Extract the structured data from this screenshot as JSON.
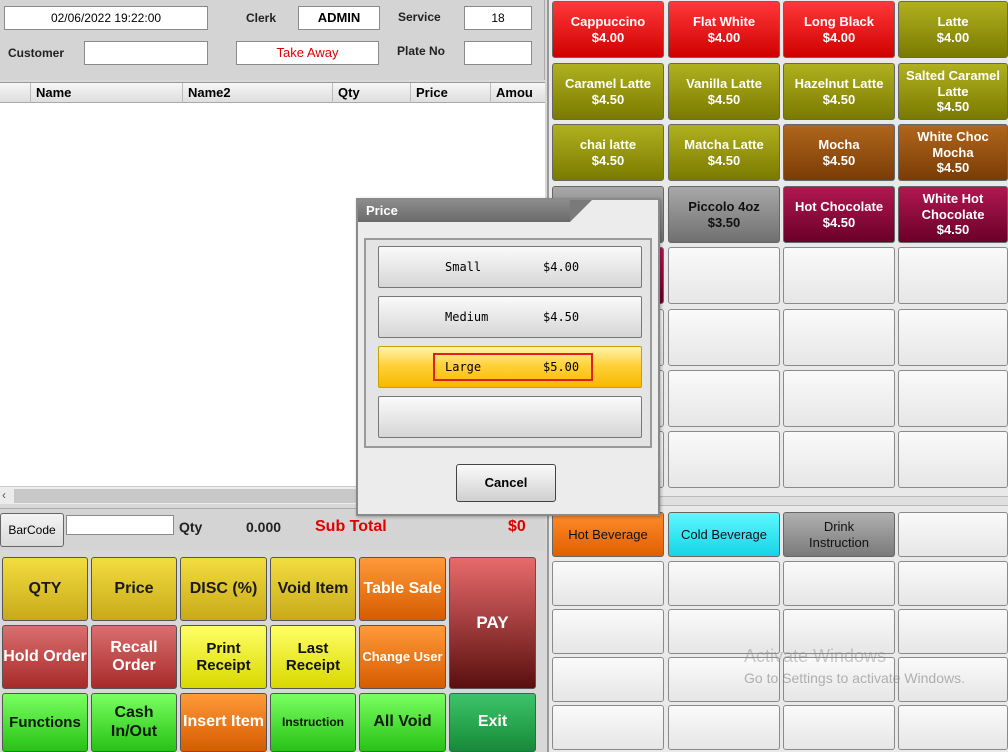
{
  "header": {
    "datetime": "02/06/2022 19:22:00",
    "clerk_label": "Clerk",
    "clerk_value": "ADMIN",
    "service_label": "Service",
    "service_value": "18",
    "customer_label": "Customer",
    "customer_value": "",
    "order_type": "Take Away",
    "plate_label": "Plate No",
    "plate_value": ""
  },
  "order_grid": {
    "columns": [
      "Name",
      "Name2",
      "Qty",
      "Price",
      "Amou"
    ]
  },
  "barcode_row": {
    "barcode_label": "BarCode",
    "barcode_value": "",
    "qty_label": "Qty",
    "qty_value": "0.000",
    "subtotal_label": "Sub Total",
    "subtotal_value": "$0"
  },
  "functions": {
    "qty": "QTY",
    "price": "Price",
    "disc": "DISC (%)",
    "void_item": "Void Item",
    "table_sale": "Table Sale",
    "hold_order": "Hold Order",
    "recall_order": "Recall Order",
    "print_receipt": "Print Receipt",
    "last_receipt": "Last Receipt",
    "change_user": "Change User",
    "functions": "Functions",
    "cash_in_out": "Cash In/Out",
    "insert_item": "Insert Item",
    "instruction": "Instruction",
    "all_void": "All Void",
    "exit": "Exit",
    "pay": "PAY"
  },
  "menu_items": [
    {
      "name": "Cappuccino",
      "price": "$4.00"
    },
    {
      "name": "Flat White",
      "price": "$4.00"
    },
    {
      "name": "Long Black",
      "price": "$4.00"
    },
    {
      "name": "Latte",
      "price": "$4.00"
    },
    {
      "name": "Caramel Latte",
      "price": "$4.50"
    },
    {
      "name": "Vanilla Latte",
      "price": "$4.50"
    },
    {
      "name": "Hazelnut Latte",
      "price": "$4.50"
    },
    {
      "name": "Salted Caramel Latte",
      "price": "$4.50"
    },
    {
      "name": "chai latte",
      "price": "$4.50"
    },
    {
      "name": "Matcha Latte",
      "price": "$4.50"
    },
    {
      "name": "Mocha",
      "price": "$4.50"
    },
    {
      "name": "White Choc Mocha",
      "price": "$4.50"
    },
    {
      "name": "Piccolo 4oz",
      "price": "$3.50"
    },
    {
      "name": "Hot Chocolate",
      "price": "$4.50"
    },
    {
      "name": "White Hot Chocolate",
      "price": "$4.50"
    }
  ],
  "categories": [
    "Hot Beverage",
    "Cold Beverage",
    "Drink Instruction"
  ],
  "colors": {
    "red": "#e00000",
    "olive": "#8c8c00",
    "brown": "#8c4a0c",
    "maroon": "#7a0030",
    "selected": "#ffd23a",
    "subtotal": "#e00000"
  },
  "price_dialog": {
    "title": "Price",
    "options": [
      {
        "size": "Small",
        "price": "$4.00"
      },
      {
        "size": "Medium",
        "price": "$4.50"
      },
      {
        "size": "Large",
        "price": "$5.00"
      }
    ],
    "selected_index": 2,
    "cancel_label": "Cancel"
  },
  "watermark": {
    "line1": "Activate Windows",
    "line2": "Go to Settings to activate Windows."
  }
}
